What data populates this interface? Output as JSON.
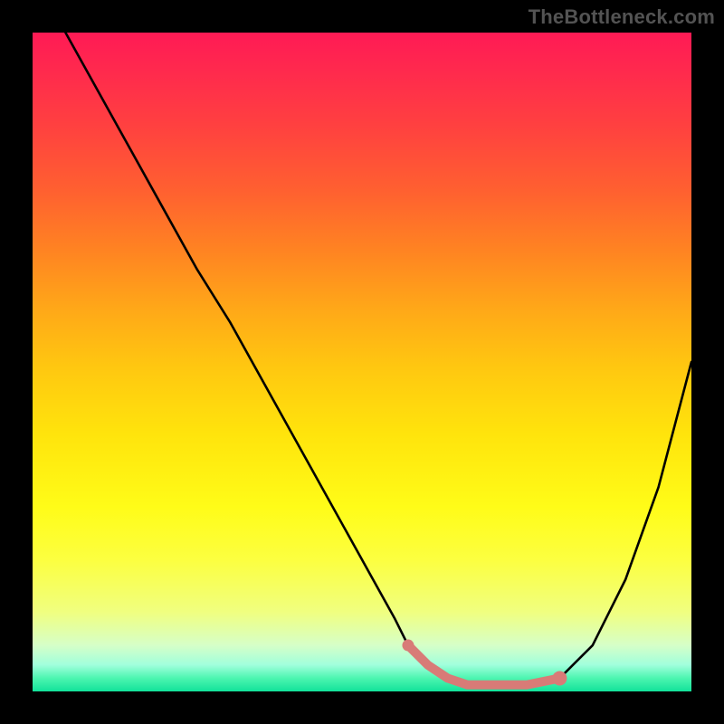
{
  "watermark": "TheBottleneck.com",
  "colors": {
    "page_bg": "#000000",
    "gradient_top": "#ff1a55",
    "gradient_bottom": "#12e29a",
    "curve_stroke": "#000000",
    "marker_stroke": "#d87b77",
    "watermark_text": "#535353"
  },
  "chart_data": {
    "type": "line",
    "title": "",
    "xlabel": "",
    "ylabel": "",
    "xlim": [
      0,
      100
    ],
    "ylim": [
      0,
      100
    ],
    "grid": false,
    "legend": null,
    "series": [
      {
        "name": "bottleneck-curve",
        "x": [
          5,
          10,
          15,
          20,
          25,
          30,
          35,
          40,
          45,
          50,
          55,
          57,
          60,
          63,
          66,
          70,
          75,
          80,
          85,
          90,
          95,
          100
        ],
        "y": [
          100,
          91,
          82,
          73,
          64,
          56,
          47,
          38,
          29,
          20,
          11,
          7,
          4,
          2,
          1,
          1,
          1,
          2,
          7,
          17,
          31,
          50
        ]
      }
    ],
    "markers": [
      {
        "name": "highlight-segment",
        "x": [
          57,
          60,
          63,
          66,
          70,
          75,
          80
        ],
        "y": [
          7,
          4,
          2,
          1,
          1,
          1,
          2
        ]
      }
    ],
    "annotations": [
      {
        "text": "TheBottleneck.com",
        "position": "top-right"
      }
    ]
  }
}
